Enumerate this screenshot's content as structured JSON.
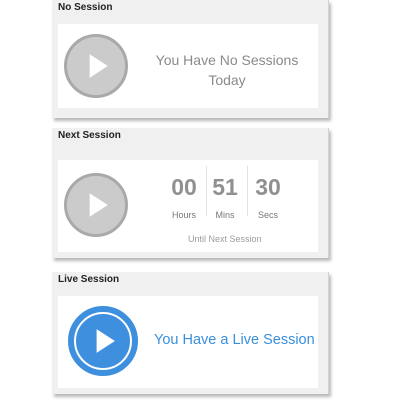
{
  "no_session": {
    "title": "No Session",
    "message_line1": "You Have No Sessions",
    "message_line2": "Today"
  },
  "next_session": {
    "title": "Next Session",
    "hours_value": "00",
    "mins_value": "51",
    "secs_value": "30",
    "hours_label": "Hours",
    "mins_label": "Mins",
    "secs_label": "Secs",
    "until_text": "Until Next Session"
  },
  "live_session": {
    "title": "Live Session",
    "message": "You Have a Live Session"
  },
  "icons": {
    "grey_play": "play-icon",
    "live_play": "play-icon"
  },
  "colors": {
    "inactive_grey": "#cbcbcb",
    "live_blue": "#3f8fdf"
  }
}
